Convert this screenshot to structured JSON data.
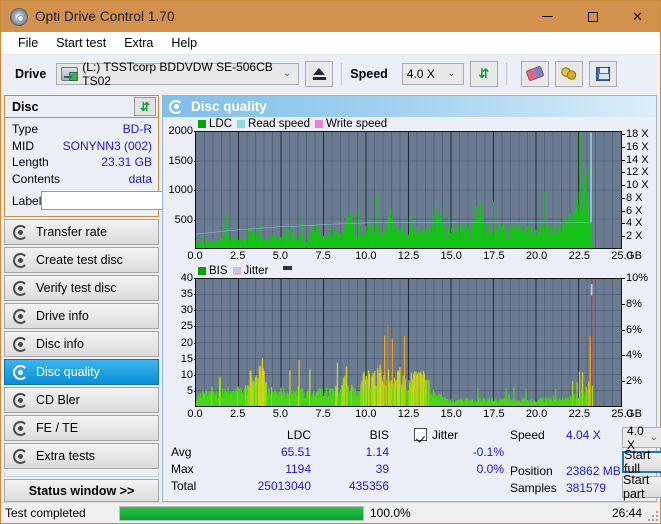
{
  "window": {
    "title": "Opti Drive Control 1.70",
    "icon": "disc-icon",
    "minimize": "─",
    "maximize": "□",
    "close": "✕"
  },
  "menu": {
    "items": [
      "File",
      "Start test",
      "Extra",
      "Help"
    ]
  },
  "toolbar": {
    "drive_label": "Drive",
    "drive_value": "(L:)  TSSTcorp BDDVDW SE-506CB TS02",
    "speed_label": "Speed",
    "speed_value": "4.0 X",
    "eject_icon": "eject-icon",
    "refresh_icon": "refresh-icon",
    "erase_icon": "eraser-icon",
    "bookmark_icon": "gold-disc-icon",
    "save_icon": "floppy-save-icon",
    "dropdown_arrow": "⌄"
  },
  "disc": {
    "panel_title": "Disc",
    "refresh_icon": "refresh-icon",
    "rows": [
      {
        "label": "Type",
        "value": "BD-R"
      },
      {
        "label": "MID",
        "value": "SONYNN3 (002)"
      },
      {
        "label": "Length",
        "value": "23.31 GB"
      },
      {
        "label": "Contents",
        "value": "data"
      }
    ],
    "label_field_label": "Label",
    "label_field_value": "",
    "label_field_placeholder": "",
    "disc_button_icon": "cd-icon"
  },
  "nav": {
    "items": [
      {
        "label": "Transfer rate",
        "active": false
      },
      {
        "label": "Create test disc",
        "active": false
      },
      {
        "label": "Verify test disc",
        "active": false
      },
      {
        "label": "Drive info",
        "active": false
      },
      {
        "label": "Disc info",
        "active": false
      },
      {
        "label": "Disc quality",
        "active": true
      },
      {
        "label": "CD Bler",
        "active": false
      },
      {
        "label": "FE / TE",
        "active": false
      },
      {
        "label": "Extra tests",
        "active": false
      }
    ],
    "status_window": "Status window >>"
  },
  "panel": {
    "title": "Disc quality",
    "icon": "disc-quality-icon"
  },
  "chart_data": [
    {
      "id": "top",
      "type": "area",
      "title": "LDC / Read speed",
      "legend": [
        {
          "label": "LDC",
          "color": "#00a400"
        },
        {
          "label": "Read speed",
          "color": "#8fd6f5"
        },
        {
          "label": "Write speed",
          "color": "#f57fd8"
        }
      ],
      "legend_position": "top-left",
      "grid": true,
      "xlabel": "GB",
      "xlim": [
        0,
        25
      ],
      "xticks": [
        0,
        2.5,
        5,
        7.5,
        10,
        12.5,
        15,
        17.5,
        20,
        22.5,
        25
      ],
      "xticklabels": [
        "0.0",
        "2.5",
        "5.0",
        "7.5",
        "10.0",
        "12.5",
        "15.0",
        "17.5",
        "20.0",
        "22.5",
        "25.0"
      ],
      "ylabel": "LDC",
      "ylim": [
        0,
        2000
      ],
      "yticks": [
        500,
        1000,
        1500,
        2000
      ],
      "yticklabels": [
        "500",
        "1000",
        "1500",
        "2000"
      ],
      "y2label": "X",
      "y2lim": [
        0,
        18.5
      ],
      "y2ticks": [
        2,
        4,
        6,
        8,
        10,
        12,
        14,
        16,
        18
      ],
      "y2ticklabels": [
        "2 X",
        "4 X",
        "6 X",
        "8 X",
        "10 X",
        "12 X",
        "14 X",
        "16 X",
        "18 X"
      ],
      "series": [
        {
          "name": "Read speed",
          "axis": "right",
          "color": "#8fd6f5",
          "x": [
            0.0,
            1.0,
            2.0,
            3.0,
            4.0,
            5.0,
            6.0,
            7.0,
            8.0,
            9.0,
            10.0,
            11.0,
            12.0,
            13.0,
            14.0,
            16.0,
            18.0,
            20.0,
            22.0,
            23.2,
            23.25,
            23.3
          ],
          "values": [
            2.2,
            2.5,
            2.8,
            3.0,
            3.2,
            3.4,
            3.5,
            3.65,
            3.8,
            3.9,
            4.0,
            4.05,
            4.08,
            4.1,
            4.1,
            4.1,
            4.1,
            4.1,
            4.1,
            4.1,
            18.4,
            18.4
          ]
        },
        {
          "name": "LDC",
          "axis": "left",
          "color": "#15c415",
          "x": [
            0.0,
            0.3,
            0.7,
            1.0,
            1.4,
            1.8,
            2.2,
            2.6,
            3.0,
            3.4,
            3.8,
            4.2,
            4.6,
            5.0,
            5.4,
            5.8,
            6.2,
            6.6,
            7.0,
            7.4,
            7.8,
            8.2,
            8.6,
            9.0,
            9.4,
            9.8,
            10.2,
            10.6,
            11.0,
            11.4,
            11.8,
            12.2,
            12.6,
            13.0,
            13.4,
            13.8,
            14.2,
            14.6,
            15.0,
            15.4,
            15.8,
            16.2,
            16.6,
            17.0,
            17.4,
            17.8,
            18.2,
            18.6,
            19.0,
            19.4,
            19.8,
            20.2,
            20.6,
            21.0,
            21.4,
            21.8,
            22.2,
            22.6,
            23.0,
            23.2,
            23.3
          ],
          "values": [
            80,
            110,
            95,
            130,
            100,
            250,
            140,
            120,
            180,
            300,
            160,
            140,
            200,
            150,
            330,
            170,
            190,
            150,
            420,
            200,
            180,
            260,
            230,
            540,
            280,
            250,
            470,
            310,
            300,
            560,
            290,
            280,
            330,
            300,
            290,
            320,
            700,
            310,
            300,
            350,
            330,
            300,
            880,
            340,
            320,
            360,
            330,
            310,
            350,
            330,
            320,
            370,
            350,
            330,
            380,
            420,
            500,
            900,
            1150,
            400,
            60
          ]
        }
      ],
      "read_speed_jump_gb": 23.2,
      "data_end_gb": 23.31
    },
    {
      "id": "bottom",
      "type": "area",
      "title": "BIS / Jitter",
      "legend": [
        {
          "label": "BIS",
          "color": "#00a400"
        },
        {
          "label": "Jitter",
          "color": "#d8b9e0"
        }
      ],
      "legend_position": "top-left",
      "grid": true,
      "xlabel": "GB",
      "xlim": [
        0,
        25
      ],
      "xticks": [
        0,
        2.5,
        5,
        7.5,
        10,
        12.5,
        15,
        17.5,
        20,
        22.5,
        25
      ],
      "xticklabels": [
        "0.0",
        "2.5",
        "5.0",
        "7.5",
        "10.0",
        "12.5",
        "15.0",
        "17.5",
        "20.0",
        "22.5",
        "25.0"
      ],
      "ylabel": "BIS",
      "ylim": [
        0,
        40
      ],
      "yticks": [
        5,
        10,
        15,
        20,
        25,
        30,
        35,
        40
      ],
      "yticklabels": [
        "5",
        "10",
        "15",
        "20",
        "25",
        "30",
        "35",
        "40"
      ],
      "y2label": "%",
      "y2lim": [
        0,
        10
      ],
      "y2ticks": [
        2,
        4,
        6,
        8,
        10
      ],
      "y2ticklabels": [
        "2%",
        "4%",
        "6%",
        "8%",
        "10%"
      ],
      "series": [
        {
          "name": "BIS",
          "axis": "left",
          "color": "#4cd41a",
          "x": [
            0.0,
            0.2,
            0.5,
            0.9,
            1.3,
            1.7,
            2.1,
            2.5,
            2.9,
            3.3,
            3.6,
            3.9,
            4.1,
            4.4,
            4.8,
            5.2,
            5.6,
            6.0,
            6.4,
            6.8,
            7.2,
            7.6,
            8.0,
            8.4,
            8.8,
            9.2,
            9.6,
            10.0,
            10.3,
            10.7,
            11.1,
            11.5,
            11.9,
            12.3,
            12.7,
            13.1,
            13.5,
            13.9,
            14.3,
            14.7,
            15.1,
            15.5,
            15.9,
            16.3,
            16.7,
            17.1,
            17.5,
            17.9,
            18.3,
            18.7,
            19.1,
            19.5,
            19.9,
            20.3,
            20.7,
            21.1,
            21.5,
            21.9,
            22.3,
            22.7,
            22.9,
            23.05,
            23.15,
            23.22,
            23.28,
            23.32
          ],
          "values": [
            2,
            4,
            4.5,
            5,
            4.5,
            5,
            4.5,
            5,
            5,
            10,
            8,
            14,
            7,
            5,
            4.5,
            5,
            4.5,
            5,
            5,
            4.5,
            5,
            4.5,
            5,
            5,
            8,
            5,
            5,
            11,
            9,
            10,
            11,
            9,
            10,
            8,
            9,
            9,
            9,
            5,
            4,
            2,
            2,
            2,
            2,
            2,
            2,
            2,
            2,
            2,
            2,
            2,
            2,
            2,
            2,
            2,
            2,
            2,
            2,
            2.5,
            3,
            4,
            5,
            7,
            12,
            22,
            39,
            6
          ]
        },
        {
          "name": "Jitter",
          "axis": "right",
          "color": "#d8b9e0",
          "x": [
            23.2
          ],
          "values": [
            9.6
          ]
        }
      ],
      "bis_spike_gb": 23.25,
      "data_end_gb": 23.32
    }
  ],
  "stats": {
    "columns": [
      "LDC",
      "BIS"
    ],
    "rows": [
      {
        "label": "Avg",
        "ldc": "65.51",
        "bis": "1.14"
      },
      {
        "label": "Max",
        "ldc": "1194",
        "bis": "39"
      },
      {
        "label": "Total",
        "ldc": "25013040",
        "bis": "435356"
      }
    ],
    "jitter": {
      "checked": true,
      "label": "Jitter",
      "avg": "-0.1%",
      "max": "0.0%",
      "total": ""
    },
    "right": [
      {
        "label": "Speed",
        "value": "4.04 X"
      },
      {
        "label": "Position",
        "value": "23862 MB"
      },
      {
        "label": "Samples",
        "value": "381579"
      }
    ],
    "speed_select": "4.0 X",
    "dropdown_arrow": "⌄",
    "start_full": "Start full",
    "start_part": "Start part"
  },
  "statusbar": {
    "text": "Test completed",
    "progress_percent": 100.0,
    "progress_label": "100.0%",
    "elapsed": "26:44"
  },
  "colors": {
    "titlebar": "#d2914c",
    "accent": "#1a1ad6",
    "plot_bg": "#6b7c92",
    "ldc_green": "#15c415",
    "read_speed": "#8fd6f5",
    "write_speed": "#f57fd8",
    "jitter": "#d8b9e0",
    "progress_green": "#06a32c",
    "active_nav": "#0b8fd6"
  }
}
